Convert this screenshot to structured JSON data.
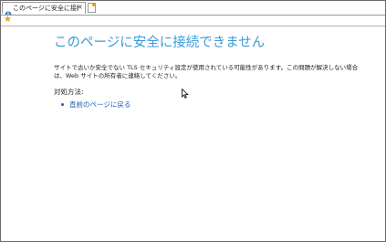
{
  "tab": {
    "title": "このページに安全に接続できま...",
    "close_glyph": "×"
  },
  "page": {
    "title": "このページに安全に接続できません",
    "description": "サイトで古いか安全でない TLS セキュリティ設定が使用されている可能性があります。この問題が解決しない場合は、Web サイトの所有者に連絡してください。",
    "remedy_heading": "対処方法:",
    "remedies": [
      {
        "label": "直前のページに戻る"
      }
    ]
  },
  "icons": {
    "tab_favicon": "error-page-icon",
    "new_tab": "new-tab-icon",
    "favorites": "favorites-star-icon",
    "pointer": "mouse-pointer-icon"
  },
  "colors": {
    "title": "#3a9bd8",
    "link": "#1a5fb4",
    "star": "#e1a12a"
  }
}
